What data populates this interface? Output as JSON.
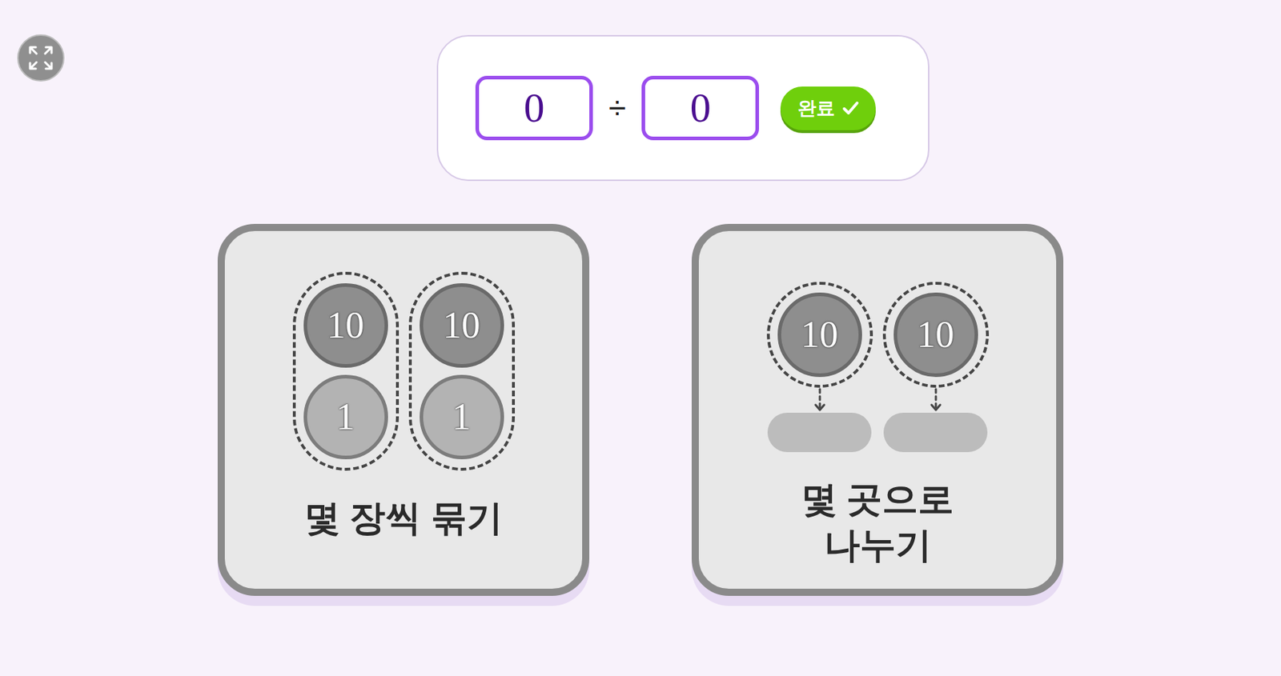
{
  "equation": {
    "dividend": "0",
    "operator": "÷",
    "divisor": "0"
  },
  "done_button": {
    "label": "완료"
  },
  "modes": [
    {
      "kind": "grouping",
      "selected": false,
      "label_lines": [
        "몇 장씩 묶기"
      ],
      "groups": [
        [
          "10",
          "1"
        ],
        [
          "10",
          "1"
        ]
      ]
    },
    {
      "kind": "sharing",
      "selected": false,
      "label_lines": [
        "몇 곳으로",
        "나누기"
      ],
      "groups": [
        [
          "10"
        ],
        [
          "10"
        ]
      ]
    }
  ]
}
